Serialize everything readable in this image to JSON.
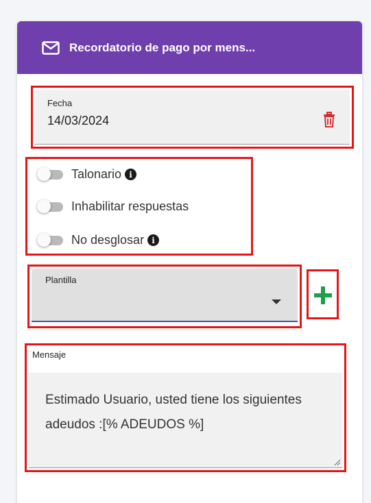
{
  "header": {
    "title": "Recordatorio de pago por mens...",
    "icon": "envelope-icon",
    "background": "#6f3fad"
  },
  "fecha": {
    "label": "Fecha",
    "value": "14/03/2024",
    "delete_icon": "trash-icon"
  },
  "toggles": [
    {
      "label": "Talonario",
      "checked": false,
      "info": true
    },
    {
      "label": "Inhabilitar respuestas",
      "checked": false,
      "info": false
    },
    {
      "label": "No desglosar",
      "checked": false,
      "info": true
    }
  ],
  "plantilla": {
    "label": "Plantilla",
    "value": ""
  },
  "add_button": {
    "icon": "plus-icon",
    "color": "#1e9e4a"
  },
  "mensaje": {
    "label": "Mensaje",
    "value": "Estimado Usuario, usted tiene los siguientes adeudos :[% ADEUDOS %]"
  },
  "colors": {
    "highlight": "#e81414",
    "accent": "#3f51b5"
  }
}
